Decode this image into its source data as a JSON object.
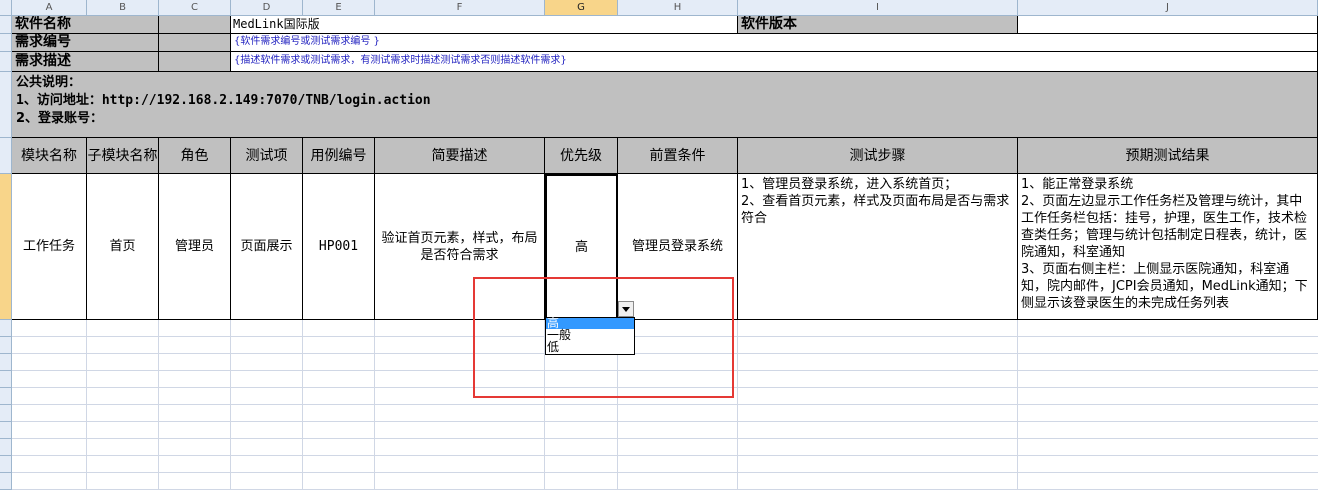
{
  "columns": [
    "A",
    "B",
    "C",
    "D",
    "E",
    "F",
    "G",
    "H",
    "I",
    "J"
  ],
  "header_rows": {
    "software_name_label": "软件名称",
    "software_name_value": "MedLink国际版",
    "software_version_label": "软件版本",
    "requirement_id_label": "需求编号",
    "requirement_id_value": "{软件需求编号或测试需求编号 }",
    "requirement_desc_label": "需求描述",
    "requirement_desc_value": "{描述软件需求或测试需求，有测试需求时描述测试需求否则描述软件需求}"
  },
  "notes": {
    "line1": "公共说明：",
    "line2": "1、访问地址：http://192.168.2.149:7070/TNB/login.action",
    "line3": "2、登录账号："
  },
  "table_headers": [
    "模块名称",
    "子模块名称",
    "角色",
    "测试项",
    "用例编号",
    "简要描述",
    "优先级",
    "前置条件",
    "测试步骤",
    "预期测试结果"
  ],
  "row": {
    "module": "工作任务",
    "submodule": "首页",
    "role": "管理员",
    "test_item": "页面展示",
    "case_id": "HP001",
    "summary": "验证首页元素，样式，布局是否符合需求",
    "priority": "高",
    "precondition": "管理员登录系统",
    "steps": [
      "1、管理员登录系统，进入系统首页；",
      "2、查看首页元素，样式及页面布局是否与需求符合"
    ],
    "expected": [
      "1、能正常登录系统",
      "2、页面左边显示工作任务栏及管理与统计，其中工作任务栏包括：挂号，护理，医生工作，技术检查类任务；管理与统计包括制定日程表，统计，医院通知，科室通知",
      "3、页面右侧主栏：上侧显示医院通知，科室通知，院内邮件，JCPI会员通知，MedLink通知；下侧显示该登录医生的未完成任务列表"
    ]
  },
  "dropdown": {
    "options": [
      "高",
      "一般",
      "低"
    ],
    "highlighted": "高"
  },
  "colors": {
    "header_bg": "#c0c0c0",
    "highlight": "#3399ff",
    "annotation_box": "#e53935",
    "selected_col": "#f8d58a"
  }
}
